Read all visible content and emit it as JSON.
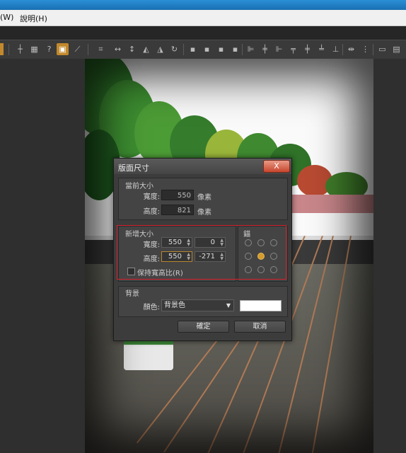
{
  "menu": {
    "item_w": "(W)",
    "help": "說明(H)"
  },
  "toolbar_icons": [
    "crop-icon",
    "grid-icon",
    "grid-dots-icon",
    "help-grid-icon",
    "resize-canvas-icon",
    "straighten-icon",
    "transform-icon",
    "flip-h-icon",
    "flip-v-icon",
    "rotate-left-icon",
    "rotate-right-icon",
    "align-left-icon",
    "align-center-icon",
    "align-right-icon",
    "align-top-icon",
    "align-middle-icon",
    "align-bottom-icon",
    "distribute-icon",
    "distribute-h-icon",
    "distribute-v-icon",
    "panel-icon",
    "panel2-icon",
    "more-icon"
  ],
  "dialog": {
    "title": "版面尺寸",
    "close": "X",
    "current_size": {
      "label": "當前大小",
      "width_label": "寬度:",
      "width_value": "550",
      "height_label": "高度:",
      "height_value": "821",
      "unit": "像素"
    },
    "new_size": {
      "label": "新增大小",
      "width_label": "寬度:",
      "width_value": "550",
      "width_offset": "0",
      "height_label": "高度:",
      "height_value": "550",
      "height_offset": "-271",
      "keep_ratio": "保持寬高比(R)"
    },
    "anchor": {
      "label": "錨",
      "selected": "center"
    },
    "background": {
      "label": "背景",
      "color_label": "顏色:",
      "color_option": "背景色",
      "swatch_color": "#ffffff"
    },
    "ok": "確定",
    "cancel": "取消"
  }
}
